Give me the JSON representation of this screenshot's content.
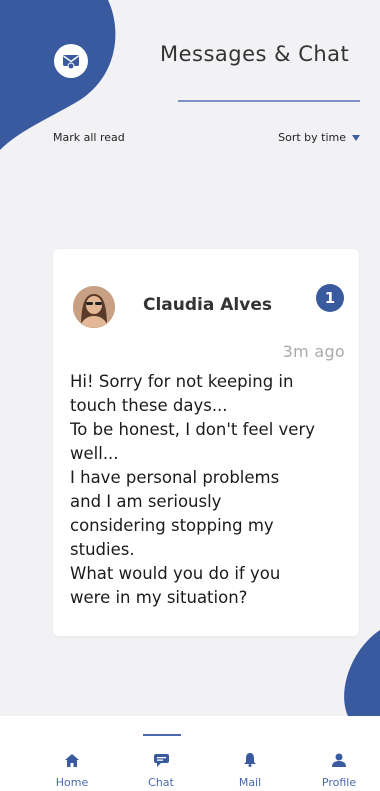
{
  "header": {
    "title": "Messages & Chat",
    "icon": "mail-notification-icon"
  },
  "actions": {
    "mark_all_read": "Mark all read",
    "sort_label": "Sort by time"
  },
  "message": {
    "sender": "Claudia Alves",
    "unread_count": "1",
    "time": "3m ago",
    "lines": [
      "Hi! Sorry for not keeping in",
      "touch these days...",
      "To be honest, I don't feel very",
      "well...",
      "I have personal problems",
      "and I am seriously",
      "considering stopping my",
      "studies.",
      "What would you do if you",
      "were in my situation?"
    ]
  },
  "nav": {
    "items": [
      {
        "label": "Home",
        "icon": "home-icon"
      },
      {
        "label": "Chat",
        "icon": "chat-icon",
        "active": true
      },
      {
        "label": "Mail",
        "icon": "bell-icon"
      },
      {
        "label": "Profile",
        "icon": "profile-icon"
      }
    ]
  },
  "colors": {
    "accent": "#3a5a9f",
    "nav_text": "#4a6aad",
    "background": "#f2f2f5"
  }
}
